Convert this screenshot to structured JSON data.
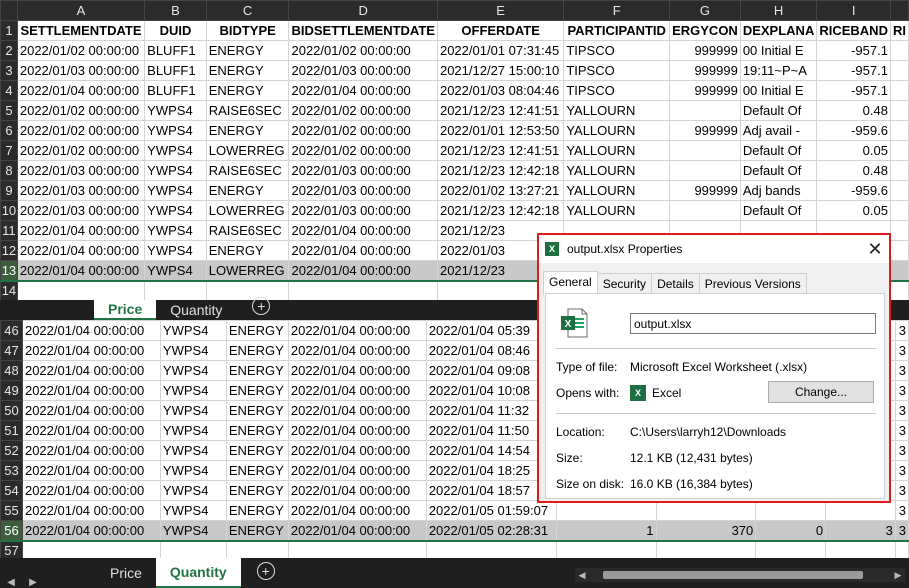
{
  "columns": [
    "A",
    "B",
    "C",
    "D",
    "E",
    "F",
    "G",
    "H",
    "I",
    ""
  ],
  "top_headers": [
    "SETTLEMENTDATE",
    "DUID",
    "BIDTYPE",
    "BIDSETTLEMENTDATE",
    "OFFERDATE",
    "PARTICIPANTID",
    "ERGYCON",
    "DEXPLANA",
    "RICEBAND",
    "RI"
  ],
  "top_rows": [
    {
      "n": "2",
      "c": [
        "2022/01/02 00:00:00",
        "BLUFF1",
        "ENERGY",
        "2022/01/02 00:00:00",
        "2022/01/01 07:31:45",
        "TIPSCO",
        "999999",
        "00 Initial E",
        "-957.1",
        ""
      ]
    },
    {
      "n": "3",
      "c": [
        "2022/01/03 00:00:00",
        "BLUFF1",
        "ENERGY",
        "2022/01/03 00:00:00",
        "2021/12/27 15:00:10",
        "TIPSCO",
        "999999",
        "19:11~P~A",
        "-957.1",
        ""
      ]
    },
    {
      "n": "4",
      "c": [
        "2022/01/04 00:00:00",
        "BLUFF1",
        "ENERGY",
        "2022/01/04 00:00:00",
        "2022/01/03 08:04:46",
        "TIPSCO",
        "999999",
        "00 Initial E",
        "-957.1",
        ""
      ]
    },
    {
      "n": "5",
      "c": [
        "2022/01/02 00:00:00",
        "YWPS4",
        "RAISE6SEC",
        "2022/01/02 00:00:00",
        "2021/12/23 12:41:51",
        "YALLOURN",
        "",
        "Default Of",
        "0.48",
        ""
      ]
    },
    {
      "n": "6",
      "c": [
        "2022/01/02 00:00:00",
        "YWPS4",
        "ENERGY",
        "2022/01/02 00:00:00",
        "2022/01/01 12:53:50",
        "YALLOURN",
        "999999",
        "Adj avail -",
        "-959.6",
        ""
      ]
    },
    {
      "n": "7",
      "c": [
        "2022/01/02 00:00:00",
        "YWPS4",
        "LOWERREG",
        "2022/01/02 00:00:00",
        "2021/12/23 12:41:51",
        "YALLOURN",
        "",
        "Default Of",
        "0.05",
        ""
      ]
    },
    {
      "n": "8",
      "c": [
        "2022/01/03 00:00:00",
        "YWPS4",
        "RAISE6SEC",
        "2022/01/03 00:00:00",
        "2021/12/23 12:42:18",
        "YALLOURN",
        "",
        "Default Of",
        "0.48",
        ""
      ]
    },
    {
      "n": "9",
      "c": [
        "2022/01/03 00:00:00",
        "YWPS4",
        "ENERGY",
        "2022/01/03 00:00:00",
        "2022/01/02 13:27:21",
        "YALLOURN",
        "999999",
        "Adj bands",
        "-959.6",
        ""
      ]
    },
    {
      "n": "10",
      "c": [
        "2022/01/03 00:00:00",
        "YWPS4",
        "LOWERREG",
        "2022/01/03 00:00:00",
        "2021/12/23 12:42:18",
        "YALLOURN",
        "",
        "Default Of",
        "0.05",
        ""
      ]
    },
    {
      "n": "11",
      "c": [
        "2022/01/04 00:00:00",
        "YWPS4",
        "RAISE6SEC",
        "2022/01/04 00:00:00",
        "2021/12/23",
        "",
        "",
        "",
        "",
        ""
      ]
    },
    {
      "n": "12",
      "c": [
        "2022/01/04 00:00:00",
        "YWPS4",
        "ENERGY",
        "2022/01/04 00:00:00",
        "2022/01/03",
        "",
        "",
        "",
        "",
        ""
      ]
    },
    {
      "n": "13",
      "c": [
        "2022/01/04 00:00:00",
        "YWPS4",
        "LOWERREG",
        "2022/01/04 00:00:00",
        "2021/12/23",
        "",
        "",
        "",
        "",
        ""
      ],
      "sel": true
    },
    {
      "n": "14",
      "c": [
        "",
        "",
        "",
        "",
        "",
        "",
        "",
        "",
        "",
        ""
      ]
    }
  ],
  "bottom_rows": [
    {
      "n": "46",
      "c": [
        "2022/01/04 00:00:00",
        "YWPS4",
        "ENERGY",
        "2022/01/04 00:00:00",
        "2022/01/04 05:39",
        "",
        "",
        "",
        ""
      ]
    },
    {
      "n": "47",
      "c": [
        "2022/01/04 00:00:00",
        "YWPS4",
        "ENERGY",
        "2022/01/04 00:00:00",
        "2022/01/04 08:46",
        "",
        "",
        "",
        ""
      ]
    },
    {
      "n": "48",
      "c": [
        "2022/01/04 00:00:00",
        "YWPS4",
        "ENERGY",
        "2022/01/04 00:00:00",
        "2022/01/04 09:08",
        "",
        "",
        "",
        ""
      ]
    },
    {
      "n": "49",
      "c": [
        "2022/01/04 00:00:00",
        "YWPS4",
        "ENERGY",
        "2022/01/04 00:00:00",
        "2022/01/04 10:08",
        "",
        "",
        "",
        ""
      ]
    },
    {
      "n": "50",
      "c": [
        "2022/01/04 00:00:00",
        "YWPS4",
        "ENERGY",
        "2022/01/04 00:00:00",
        "2022/01/04 11:32",
        "",
        "",
        "",
        ""
      ]
    },
    {
      "n": "51",
      "c": [
        "2022/01/04 00:00:00",
        "YWPS4",
        "ENERGY",
        "2022/01/04 00:00:00",
        "2022/01/04 11:50",
        "",
        "",
        "",
        ""
      ]
    },
    {
      "n": "52",
      "c": [
        "2022/01/04 00:00:00",
        "YWPS4",
        "ENERGY",
        "2022/01/04 00:00:00",
        "2022/01/04 14:54",
        "",
        "",
        "",
        ""
      ]
    },
    {
      "n": "53",
      "c": [
        "2022/01/04 00:00:00",
        "YWPS4",
        "ENERGY",
        "2022/01/04 00:00:00",
        "2022/01/04 18:25",
        "",
        "",
        "",
        ""
      ]
    },
    {
      "n": "54",
      "c": [
        "2022/01/04 00:00:00",
        "YWPS4",
        "ENERGY",
        "2022/01/04 00:00:00",
        "2022/01/04 18:57",
        "",
        "",
        "",
        ""
      ]
    },
    {
      "n": "55",
      "c": [
        "2022/01/04 00:00:00",
        "YWPS4",
        "ENERGY",
        "2022/01/04 00:00:00",
        "2022/01/05 01:59:07",
        "",
        "",
        "",
        ""
      ]
    },
    {
      "n": "56",
      "c": [
        "2022/01/04 00:00:00",
        "YWPS4",
        "ENERGY",
        "2022/01/04 00:00:00",
        "2022/01/05 02:28:31",
        "1",
        "370",
        "0",
        "3"
      ],
      "sel": true
    },
    {
      "n": "57",
      "c": [
        "",
        "",
        "",
        "",
        "",
        "",
        "",
        "",
        ""
      ]
    },
    {
      "n": "58",
      "c": [
        "",
        "",
        "",
        "",
        "",
        "",
        "",
        "",
        ""
      ]
    }
  ],
  "bottom_right_col": [
    "3",
    "3",
    "3",
    "3",
    "3",
    "3",
    "3",
    "3",
    "3",
    "3",
    "3",
    "",
    ""
  ],
  "sheets_top": {
    "tab1": "Price",
    "tab2": "Quantity"
  },
  "sheets_bottom": {
    "tab1": "Price",
    "tab2": "Quantity"
  },
  "dialog": {
    "title": "output.xlsx Properties",
    "close": "✕",
    "tabs": [
      "General",
      "Security",
      "Details",
      "Previous Versions"
    ],
    "filename": "output.xlsx",
    "type_label": "Type of file:",
    "type_value": "Microsoft Excel Worksheet (.xlsx)",
    "opens_label": "Opens with:",
    "opens_value": "Excel",
    "change_button": "Change...",
    "location_label": "Location:",
    "location_value": "C:\\Users\\larryh12\\Downloads",
    "size_label": "Size:",
    "size_value": "12.1 KB (12,431 bytes)",
    "disk_label": "Size on disk:",
    "disk_value": "16.0 KB (16,384 bytes)",
    "icon_letter": "X"
  },
  "colors": {
    "excel_green": "#217346",
    "highlight_border": "#e01b1b"
  }
}
